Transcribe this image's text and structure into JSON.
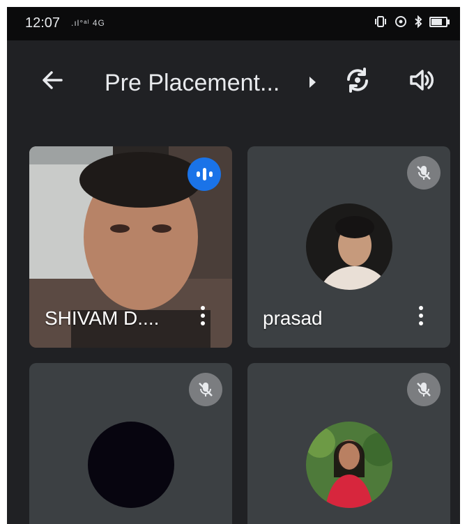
{
  "status_bar": {
    "time": "12:07",
    "signal_text": ".ıl°ᵃˡ 4G"
  },
  "app_bar": {
    "back_icon": "arrow-left-icon",
    "meeting_title": "Pre Placement...",
    "switch_camera_icon": "camera-switch-icon",
    "speaker_icon": "volume-icon"
  },
  "participants": [
    {
      "name": "SHIVAM D....",
      "state": "speaking",
      "has_video": true
    },
    {
      "name": "prasad",
      "state": "muted",
      "has_video": false
    },
    {
      "name": "",
      "state": "muted",
      "has_video": false
    },
    {
      "name": "",
      "state": "muted",
      "has_video": false
    }
  ],
  "colors": {
    "background": "#202124",
    "tile": "#3c4043",
    "speaking_accent": "#1a73e8",
    "muted_badge": "#7b7d80"
  }
}
